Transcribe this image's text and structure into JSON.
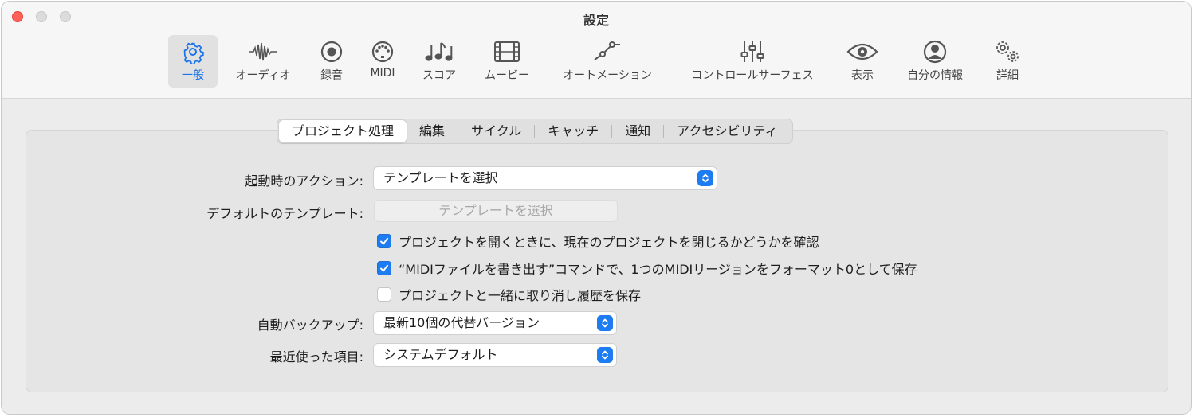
{
  "window": {
    "title": "設定"
  },
  "toolbar": {
    "items": [
      {
        "label": "一般",
        "icon": "gear-icon",
        "active": true
      },
      {
        "label": "オーディオ",
        "icon": "waveform-icon"
      },
      {
        "label": "録音",
        "icon": "record-icon"
      },
      {
        "label": "MIDI",
        "icon": "midi-connector-icon"
      },
      {
        "label": "スコア",
        "icon": "music-notes-icon"
      },
      {
        "label": "ムービー",
        "icon": "film-icon"
      },
      {
        "label": "オートメーション",
        "icon": "automation-curve-icon"
      },
      {
        "label": "コントロールサーフェス",
        "icon": "sliders-icon"
      },
      {
        "label": "表示",
        "icon": "eye-icon"
      },
      {
        "label": "自分の情報",
        "icon": "person-circle-icon"
      },
      {
        "label": "詳細",
        "icon": "gears-icon"
      }
    ]
  },
  "tabs": {
    "items": [
      "プロジェクト処理",
      "編集",
      "サイクル",
      "キャッチ",
      "通知",
      "アクセシビリティ"
    ],
    "selected": "プロジェクト処理"
  },
  "form": {
    "startup_action": {
      "label": "起動時のアクション:",
      "value": "テンプレートを選択"
    },
    "default_template": {
      "label": "デフォルトのテンプレート:",
      "button": "テンプレートを選択"
    },
    "checkboxes": [
      {
        "label": "プロジェクトを開くときに、現在のプロジェクトを閉じるかどうかを確認",
        "checked": true
      },
      {
        "label": "“MIDIファイルを書き出す”コマンドで、1つのMIDIリージョンをフォーマット0として保存",
        "checked": true
      },
      {
        "label": "プロジェクトと一緒に取り消し履歴を保存",
        "checked": false
      }
    ],
    "auto_backup": {
      "label": "自動バックアップ:",
      "value": "最新10個の代替バージョン"
    },
    "recent_items": {
      "label": "最近使った項目:",
      "value": "システムデフォルト"
    }
  },
  "colors": {
    "accent": "#1d7cf2",
    "close": "#fe5f57"
  }
}
